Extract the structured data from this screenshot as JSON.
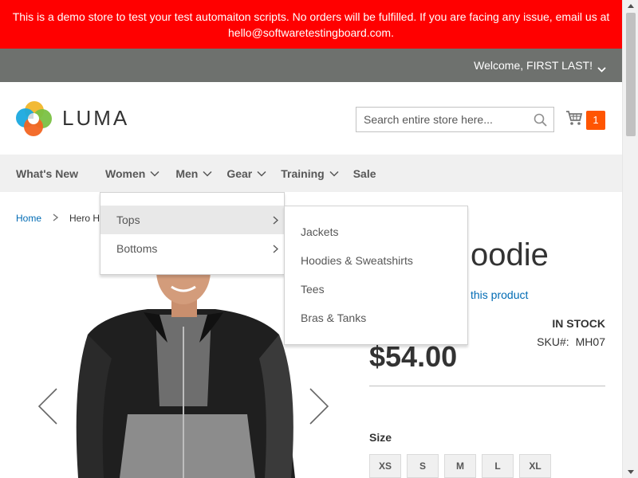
{
  "demo_notice": {
    "line1": "This is a demo store to test your test automaiton scripts. No orders will be fulfilled. If you are facing any issue, email us at",
    "line2": "hello@softwaretestingboard.com."
  },
  "header_panel": {
    "welcome": "Welcome, FIRST LAST!"
  },
  "logo": {
    "text": "LUMA"
  },
  "search": {
    "placeholder": "Search entire store here...",
    "value": ""
  },
  "minicart": {
    "count": "1"
  },
  "nav": {
    "items": [
      {
        "label": "What's New"
      },
      {
        "label": "Women"
      },
      {
        "label": "Men"
      },
      {
        "label": "Gear"
      },
      {
        "label": "Training"
      },
      {
        "label": "Sale"
      }
    ]
  },
  "breadcrumbs": {
    "home": "Home",
    "current": "Hero H"
  },
  "women_menu": {
    "items": [
      {
        "label": "Tops"
      },
      {
        "label": "Bottoms"
      }
    ],
    "tops_submenu": [
      {
        "label": "Jackets"
      },
      {
        "label": "Hoodies & Sweatshirts"
      },
      {
        "label": "Tees"
      },
      {
        "label": "Bras & Tanks"
      }
    ]
  },
  "product": {
    "title_visible": "oodie",
    "review_link": "w this product",
    "stock": "IN STOCK",
    "sku_label": "SKU#:",
    "sku": "MH07",
    "price": "$54.00",
    "size_label": "Size",
    "sizes": [
      "XS",
      "S",
      "M",
      "L",
      "XL"
    ]
  },
  "colors": {
    "notice_bg": "#ff0000",
    "panel_bg": "#6e716e",
    "nav_bg": "#f0f0f0",
    "link": "#006bb4",
    "cart_counter": "#ff5501"
  }
}
